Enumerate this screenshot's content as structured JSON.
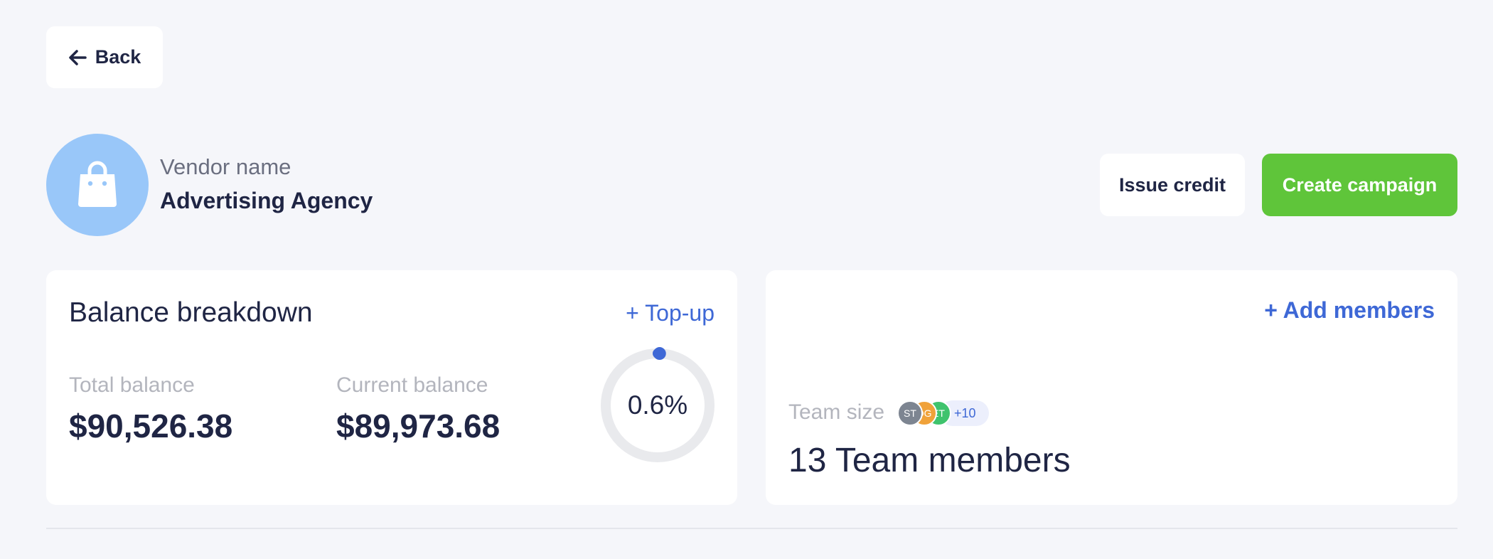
{
  "header": {
    "back_label": "Back",
    "back_icon": "arrow-left-icon"
  },
  "vendor": {
    "label": "Vendor name",
    "name": "Advertising Agency",
    "avatar_icon": "shopping-bag-icon",
    "avatar_color": "#99c7f9"
  },
  "actions": {
    "issue_credit_label": "Issue credit",
    "create_campaign_label": "Create campaign",
    "create_campaign_color": "#5fc53a"
  },
  "balance": {
    "title": "Balance breakdown",
    "topup_label": "+ Top-up",
    "total_label": "Total balance",
    "total_value": "$90,526.38",
    "current_label": "Current balance",
    "current_value": "$89,973.68",
    "usage_percent_text": "0.6%",
    "usage_fraction": 0.006,
    "gauge_color": "#3e68d6"
  },
  "team": {
    "add_members_label": "+ Add members",
    "size_label": "Team size",
    "avatars": [
      {
        "initials": "ST",
        "color": "#7d8591"
      },
      {
        "initials": "DG",
        "color": "#f0a23a"
      },
      {
        "initials": "ET",
        "color": "#3fc36d"
      }
    ],
    "more_label": "+10",
    "count_text": "13 Team members"
  },
  "colors": {
    "accent": "#3e68d6",
    "background": "#f5f6fa"
  }
}
